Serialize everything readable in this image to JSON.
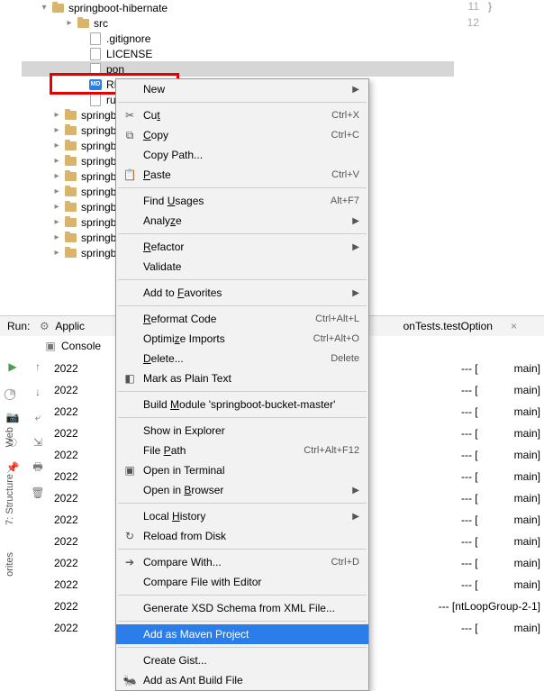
{
  "tree": {
    "root": "springboot-hibernate",
    "nodes": [
      {
        "arrow": "▾",
        "icon": "folder",
        "label": "springboot-hibernate",
        "indent": 18
      },
      {
        "arrow": "▸",
        "icon": "folder",
        "label": "src",
        "indent": 46
      },
      {
        "arrow": "",
        "icon": "file",
        "label": ".gitignore",
        "indent": 60
      },
      {
        "arrow": "",
        "icon": "file",
        "label": "LICENSE",
        "indent": 60
      },
      {
        "arrow": "",
        "icon": "file",
        "label": "pon",
        "indent": 60,
        "selected": true
      },
      {
        "arrow": "",
        "icon": "md",
        "label": "REA",
        "indent": 60
      },
      {
        "arrow": "",
        "icon": "file",
        "label": "run.",
        "indent": 60
      },
      {
        "arrow": "▸",
        "icon": "folder",
        "label": "springb",
        "indent": 32
      },
      {
        "arrow": "▸",
        "icon": "folder",
        "label": "springb",
        "indent": 32
      },
      {
        "arrow": "▸",
        "icon": "folder",
        "label": "springb",
        "indent": 32
      },
      {
        "arrow": "▸",
        "icon": "folder",
        "label": "springb",
        "indent": 32
      },
      {
        "arrow": "▸",
        "icon": "folder",
        "label": "springb",
        "indent": 32
      },
      {
        "arrow": "▸",
        "icon": "folder",
        "label": "springb",
        "indent": 32
      },
      {
        "arrow": "▸",
        "icon": "folder",
        "label": "springb",
        "indent": 32
      },
      {
        "arrow": "▸",
        "icon": "folder",
        "label": "springb",
        "indent": 32
      },
      {
        "arrow": "▸",
        "icon": "folder",
        "label": "springb",
        "indent": 32
      },
      {
        "arrow": "▸",
        "icon": "folder",
        "label": "springb",
        "indent": 32
      }
    ]
  },
  "code": {
    "lines": [
      "11",
      "12"
    ],
    "brace": "}"
  },
  "menu": {
    "items": [
      {
        "type": "item",
        "icon": "",
        "label": "New",
        "short": "",
        "sub": true
      },
      {
        "type": "sep"
      },
      {
        "type": "item",
        "icon": "✂",
        "label": "Cut",
        "ul": "t",
        "short": "Ctrl+X"
      },
      {
        "type": "item",
        "icon": "⧉",
        "label": "Copy",
        "ul": "C",
        "short": "Ctrl+C"
      },
      {
        "type": "item",
        "icon": "",
        "label": "Copy Path...",
        "short": ""
      },
      {
        "type": "item",
        "icon": "📋",
        "label": "Paste",
        "ul": "P",
        "short": "Ctrl+V"
      },
      {
        "type": "sep"
      },
      {
        "type": "item",
        "icon": "",
        "label": "Find Usages",
        "ul": "U",
        "short": "Alt+F7"
      },
      {
        "type": "item",
        "icon": "",
        "label": "Analyze",
        "ul": "z",
        "short": "",
        "sub": true
      },
      {
        "type": "sep"
      },
      {
        "type": "item",
        "icon": "",
        "label": "Refactor",
        "ul": "R",
        "short": "",
        "sub": true
      },
      {
        "type": "item",
        "icon": "",
        "label": "Validate",
        "short": ""
      },
      {
        "type": "sep"
      },
      {
        "type": "item",
        "icon": "",
        "label": "Add to Favorites",
        "ul": "F",
        "short": "",
        "sub": true
      },
      {
        "type": "sep"
      },
      {
        "type": "item",
        "icon": "",
        "label": "Reformat Code",
        "ul": "R",
        "short": "Ctrl+Alt+L"
      },
      {
        "type": "item",
        "icon": "",
        "label": "Optimize Imports",
        "ul": "z",
        "short": "Ctrl+Alt+O"
      },
      {
        "type": "item",
        "icon": "",
        "label": "Delete...",
        "ul": "D",
        "short": "Delete"
      },
      {
        "type": "item",
        "icon": "◧",
        "label": "Mark as Plain Text",
        "short": ""
      },
      {
        "type": "sep"
      },
      {
        "type": "item",
        "icon": "",
        "label": "Build Module 'springboot-bucket-master'",
        "ul": "M",
        "short": ""
      },
      {
        "type": "sep"
      },
      {
        "type": "item",
        "icon": "",
        "label": "Show in Explorer",
        "short": ""
      },
      {
        "type": "item",
        "icon": "",
        "label": "File Path",
        "ul": "P",
        "short": "Ctrl+Alt+F12"
      },
      {
        "type": "item",
        "icon": "▣",
        "label": "Open in Terminal",
        "short": ""
      },
      {
        "type": "item",
        "icon": "",
        "label": "Open in Browser",
        "ul": "B",
        "short": "",
        "sub": true
      },
      {
        "type": "sep"
      },
      {
        "type": "item",
        "icon": "",
        "label": "Local History",
        "ul": "H",
        "short": "",
        "sub": true
      },
      {
        "type": "item",
        "icon": "↻",
        "label": "Reload from Disk",
        "short": ""
      },
      {
        "type": "sep"
      },
      {
        "type": "item",
        "icon": "➔",
        "label": "Compare With...",
        "short": "Ctrl+D"
      },
      {
        "type": "item",
        "icon": "",
        "label": "Compare File with Editor",
        "short": ""
      },
      {
        "type": "sep"
      },
      {
        "type": "item",
        "icon": "",
        "label": "Generate XSD Schema from XML File...",
        "short": ""
      },
      {
        "type": "sep"
      },
      {
        "type": "item",
        "icon": "",
        "label": "Add as Maven Project",
        "short": "",
        "hl": true
      },
      {
        "type": "sep"
      },
      {
        "type": "item",
        "icon": "",
        "label": "Create Gist...",
        "short": ""
      },
      {
        "type": "item",
        "icon": "🐜",
        "label": "Add as Ant Build File",
        "short": ""
      }
    ]
  },
  "run": {
    "label": "Run:",
    "config": "Applic",
    "tab2": "onTests.testOption",
    "console_tab": "Console"
  },
  "console": {
    "rows": [
      {
        "t": "2022",
        "mid": "--- [",
        "r": "main]"
      },
      {
        "t": "2022",
        "mid": "--- [",
        "r": "main]"
      },
      {
        "t": "2022",
        "mid": "--- [",
        "r": "main]"
      },
      {
        "t": "2022",
        "mid": "--- [",
        "r": "main]"
      },
      {
        "t": "2022",
        "mid": "--- [",
        "r": "main]"
      },
      {
        "t": "2022",
        "mid": "--- [",
        "r": "main]"
      },
      {
        "t": "2022",
        "mid": "--- [",
        "r": "main]"
      },
      {
        "t": "2022",
        "mid": "--- [",
        "r": "main]"
      },
      {
        "t": "2022",
        "mid": "--- [",
        "r": "main]"
      },
      {
        "t": "2022",
        "mid": "--- [",
        "r": "main]"
      },
      {
        "t": "2022",
        "mid": "--- [",
        "r": "main]"
      },
      {
        "t": "2022",
        "mid": "--- [ntLoopGroup-2-1]",
        "r": ""
      },
      {
        "t": "2022",
        "mid": "--- [",
        "r": "main]"
      }
    ]
  },
  "side": {
    "tabs": [
      "Web",
      "7: Structure",
      "orites"
    ]
  }
}
